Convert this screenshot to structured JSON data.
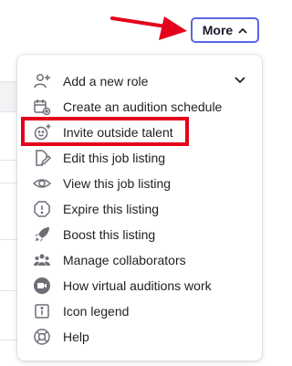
{
  "header": {
    "more_label": "More"
  },
  "menu": {
    "items": [
      {
        "label": "Add a new role",
        "icon": "add-person-icon"
      },
      {
        "label": "Create an audition schedule",
        "icon": "calendar-add-icon"
      },
      {
        "label": "Invite outside talent",
        "icon": "smiley-add-icon"
      },
      {
        "label": "Edit this job listing",
        "icon": "edit-document-icon"
      },
      {
        "label": "View this job listing",
        "icon": "eye-icon"
      },
      {
        "label": "Expire this listing",
        "icon": "alert-circle-icon"
      },
      {
        "label": "Boost this listing",
        "icon": "rocket-icon"
      },
      {
        "label": "Manage collaborators",
        "icon": "people-icon"
      },
      {
        "label": "How virtual auditions work",
        "icon": "video-icon"
      },
      {
        "label": "Icon legend",
        "icon": "info-square-icon"
      },
      {
        "label": "Help",
        "icon": "lifebuoy-icon"
      }
    ]
  },
  "colors": {
    "button_border": "#5b64e6",
    "annotation_red": "#e5001b",
    "icon_gray": "#6e6e78"
  }
}
